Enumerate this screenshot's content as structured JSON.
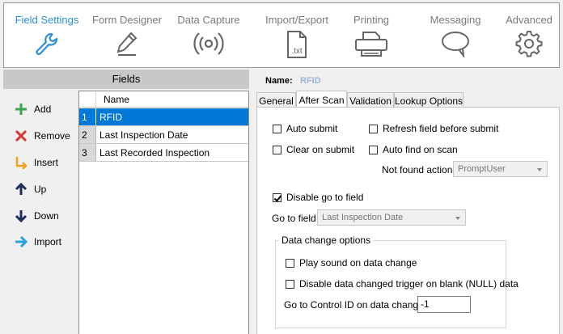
{
  "ribbon": {
    "tabs": [
      {
        "label": "Field Settings",
        "icon": "wrench-icon"
      },
      {
        "label": "Form Designer",
        "icon": "pencil-icon"
      },
      {
        "label": "Data Capture",
        "icon": "signal-icon"
      },
      {
        "label": "Import/Export",
        "icon": "txt-file-icon",
        "icon_text": ".txt"
      },
      {
        "label": "Printing",
        "icon": "printer-icon"
      },
      {
        "label": "Messaging",
        "icon": "speech-bubble-icon"
      },
      {
        "label": "Advanced",
        "icon": "gear-icon"
      }
    ],
    "active_color": "#2b8fd8",
    "inactive_color": "#7a7a7a"
  },
  "fields_panel": {
    "header": "Fields",
    "commands": [
      {
        "label": "Add",
        "icon": "plus-icon",
        "color": "#3aa64a"
      },
      {
        "label": "Remove",
        "icon": "x-icon",
        "color": "#e0302e"
      },
      {
        "label": "Insert",
        "icon": "insert-arrow-icon",
        "color": "#f0a020"
      },
      {
        "label": "Up",
        "icon": "arrow-up-icon",
        "color": "#1f2d5a"
      },
      {
        "label": "Down",
        "icon": "arrow-down-icon",
        "color": "#1f2d5a"
      },
      {
        "label": "Import",
        "icon": "arrow-right-icon",
        "color": "#2ba0e0"
      }
    ],
    "grid": {
      "column": "Name",
      "rows": [
        {
          "num": "1",
          "name": "RFID",
          "selected": true
        },
        {
          "num": "2",
          "name": "Last Inspection Date"
        },
        {
          "num": "3",
          "name": "Last Recorded Inspection"
        }
      ]
    }
  },
  "detail": {
    "name_label": "Name:",
    "name_value": "RFID",
    "tabs": [
      "General",
      "After Scan",
      "Validation",
      "Lookup Options"
    ],
    "active_tab": "After Scan",
    "after_scan": {
      "auto_submit": {
        "label": "Auto submit",
        "checked": false
      },
      "refresh_field": {
        "label": "Refresh field before submit",
        "checked": false
      },
      "clear_on_submit": {
        "label": "Clear on submit",
        "checked": false
      },
      "auto_find": {
        "label": "Auto find on scan",
        "checked": false
      },
      "not_found_label": "Not found action",
      "not_found_value": "PromptUser",
      "disable_goto": {
        "label": "Disable go to field",
        "checked": true
      },
      "goto_label": "Go to field",
      "goto_value": "Last Inspection Date",
      "data_change_group": "Data change options",
      "play_sound": {
        "label": "Play sound on data change",
        "checked": false
      },
      "disable_trigger": {
        "label": "Disable data changed trigger on blank (NULL) data",
        "checked": false
      },
      "goto_control_label": "Go to Control ID on data change",
      "goto_control_value": "-1"
    }
  }
}
